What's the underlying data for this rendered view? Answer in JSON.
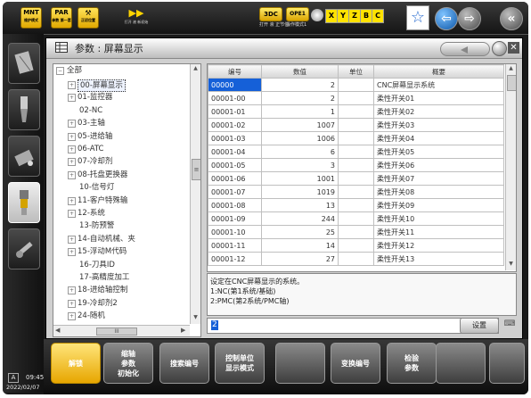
{
  "topbar": {
    "buttons": [
      {
        "label": "MNT",
        "sub": "维护模式"
      },
      {
        "label": "PAR",
        "sub": "参数\n第一套"
      },
      {
        "label": "⚒",
        "sub": "正初位置"
      },
      {
        "label": "▶▶",
        "sub": "打开 液\n新初始"
      }
    ],
    "status_3dc": "3DC",
    "status_3dc_sub": "打开 液\n正节位",
    "status_ope": "OPE1",
    "status_ope_sub": "操作模式1",
    "axes": [
      "X",
      "Y",
      "Z",
      "B",
      "C"
    ]
  },
  "screen": {
    "title": "参数 : 屏幕显示",
    "tree": {
      "root": "全部",
      "items": [
        {
          "label": "00-屏幕显示",
          "expandable": true,
          "selected": true
        },
        {
          "label": "01-监控器",
          "expandable": true
        },
        {
          "label": "02-NC",
          "expandable": false
        },
        {
          "label": "03-主轴",
          "expandable": true
        },
        {
          "label": "05-进给轴",
          "expandable": true
        },
        {
          "label": "06-ATC",
          "expandable": true
        },
        {
          "label": "07-冷却剂",
          "expandable": true
        },
        {
          "label": "08-托盘更换器",
          "expandable": true
        },
        {
          "label": "10-信号灯",
          "expandable": false
        },
        {
          "label": "11-客户特殊输",
          "expandable": true
        },
        {
          "label": "12-系统",
          "expandable": true
        },
        {
          "label": "13-防预警",
          "expandable": false
        },
        {
          "label": "14-自动机械、夹",
          "expandable": true
        },
        {
          "label": "15-浮动M代码",
          "expandable": true
        },
        {
          "label": "16-刀具ID",
          "expandable": false
        },
        {
          "label": "17-高精度加工",
          "expandable": false
        },
        {
          "label": "18-进给轴控制",
          "expandable": true
        },
        {
          "label": "19-冷却剂2",
          "expandable": true
        },
        {
          "label": "24-随机",
          "expandable": true
        }
      ]
    },
    "table": {
      "headers": [
        "编号",
        "数值",
        "单位",
        "概要"
      ],
      "rows": [
        [
          "00000",
          "2",
          "",
          "CNC屏幕显示系统"
        ],
        [
          "00001-00",
          "2",
          "",
          "柔性开关01"
        ],
        [
          "00001-01",
          "1",
          "",
          "柔性开关02"
        ],
        [
          "00001-02",
          "1007",
          "",
          "柔性开关03"
        ],
        [
          "00001-03",
          "1006",
          "",
          "柔性开关04"
        ],
        [
          "00001-04",
          "6",
          "",
          "柔性开关05"
        ],
        [
          "00001-05",
          "3",
          "",
          "柔性开关06"
        ],
        [
          "00001-06",
          "1001",
          "",
          "柔性开关07"
        ],
        [
          "00001-07",
          "1019",
          "",
          "柔性开关08"
        ],
        [
          "00001-08",
          "13",
          "",
          "柔性开关09"
        ],
        [
          "00001-09",
          "244",
          "",
          "柔性开关10"
        ],
        [
          "00001-10",
          "25",
          "",
          "柔性开关11"
        ],
        [
          "00001-11",
          "14",
          "",
          "柔性开关12"
        ],
        [
          "00001-12",
          "27",
          "",
          "柔性开关13"
        ]
      ]
    },
    "message": [
      "设定在CNC屏幕显示的系统。",
      "1:NC(第1系统/基础)",
      "2:PMC(第2系统/PMC轴)"
    ],
    "input_value": "2",
    "set_button": "设置"
  },
  "softkeys": [
    {
      "label": "解锁",
      "style": "yellow"
    },
    {
      "label": "缩轴\n参数\n初始化",
      "style": "grey"
    },
    {
      "label": "搜索编号",
      "style": "grey"
    },
    {
      "label": "控制单位\n显示模式",
      "style": "grey"
    },
    {
      "label": "",
      "style": "grey"
    },
    {
      "label": "变换编号",
      "style": "grey"
    },
    {
      "label": "检验\n参数",
      "style": "grey"
    },
    {
      "label": "",
      "style": "grey"
    },
    {
      "label": "",
      "style": "grey"
    }
  ],
  "status": {
    "mode": "A",
    "time": "09:45",
    "date": "2022/02/07"
  },
  "colors": {
    "accent_yellow": "#f0b400",
    "selected_blue": "#1560d8",
    "softkey_grey": "#6a6a6a"
  }
}
